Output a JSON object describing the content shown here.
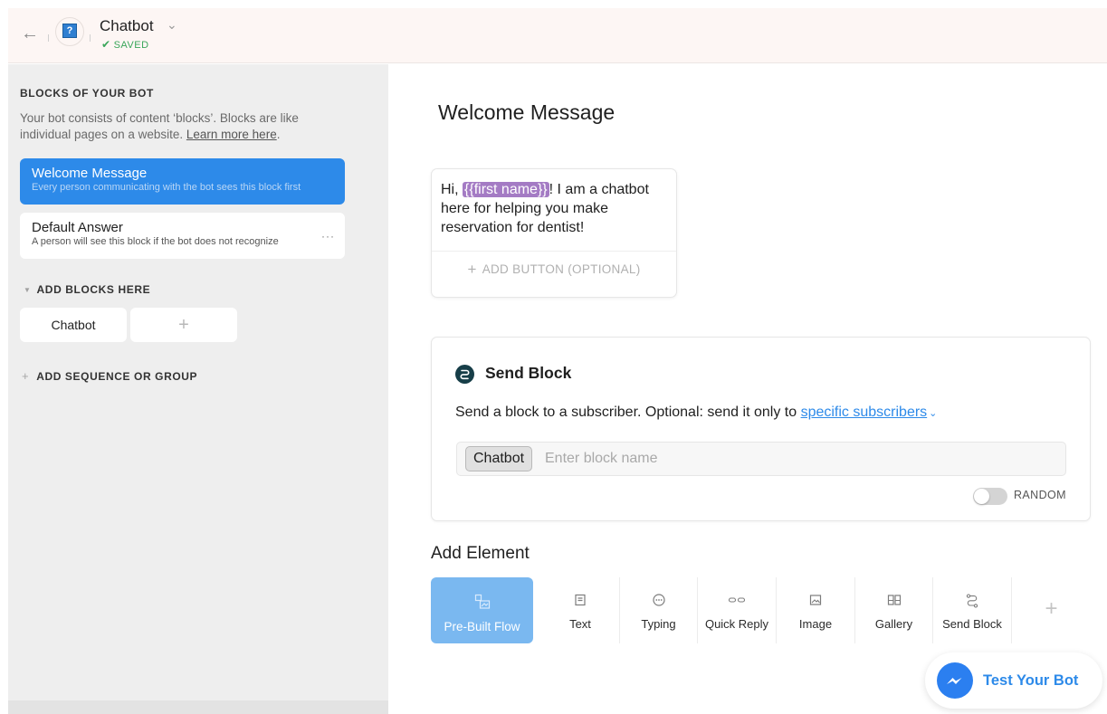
{
  "header": {
    "bot_name": "Chatbot",
    "saved_status": "SAVED",
    "bot_icon_glyph": "?"
  },
  "sidebar": {
    "heading": "BLOCKS OF YOUR BOT",
    "description": "Your bot consists of content ‘blocks’. Blocks are like individual pages on a website.",
    "learn_more": "Learn more here",
    "blocks": [
      {
        "title": "Welcome Message",
        "subtitle": "Every person communicating with the bot sees this block first"
      },
      {
        "title": "Default Answer",
        "subtitle": "A person will see this block if the bot does not recognize"
      }
    ],
    "more_glyph": "···",
    "add_blocks_label": "ADD BLOCKS HERE",
    "groups": [
      "Chatbot"
    ],
    "add_group_glyph": "+",
    "add_sequence_label": "ADD SEQUENCE OR GROUP"
  },
  "main": {
    "title": "Welcome Message",
    "text_card": {
      "greeting": "Hi,",
      "variable": "{{first name}}",
      "message_rest": "! I am a chatbot here for helping you make reservation for dentist!",
      "add_button_label": "ADD BUTTON (OPTIONAL)"
    },
    "send_block": {
      "title": "Send Block",
      "description": "Send a block to a subscriber. Optional: send it only to",
      "link": "specific subscribers",
      "chip": "Chatbot",
      "input_value": "",
      "input_placeholder": "Enter block name",
      "random_label": "RANDOM",
      "random_on": false
    },
    "add_element": {
      "title": "Add Element",
      "items": [
        {
          "label": "Pre-Built Flow",
          "icon": "pre-built-flow-icon"
        },
        {
          "label": "Text",
          "icon": "text-icon"
        },
        {
          "label": "Typing",
          "icon": "typing-icon"
        },
        {
          "label": "Quick Reply",
          "icon": "quick-reply-icon"
        },
        {
          "label": "Image",
          "icon": "image-icon"
        },
        {
          "label": "Gallery",
          "icon": "gallery-icon"
        },
        {
          "label": "Send Block",
          "icon": "send-block-icon"
        }
      ],
      "more_glyph": "+"
    }
  },
  "test_bot": {
    "label": "Test Your Bot"
  },
  "colors": {
    "accent": "#2d8ae9",
    "variable_tag": "#a47bc4",
    "saved_green": "#3aa65a",
    "sidebar_bg": "#eeeeee",
    "header_bg": "#fdf6f4"
  }
}
